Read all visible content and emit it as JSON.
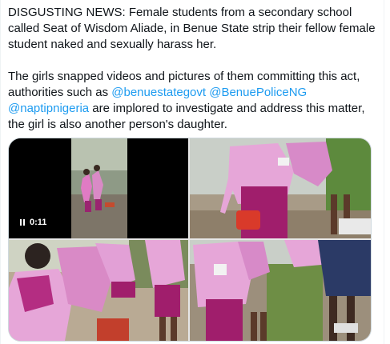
{
  "tweet": {
    "paragraph1": "DISGUSTING NEWS: Female students from a secondary school called Seat of Wisdom Aliade, in Benue State strip their fellow female student naked and sexually harass her.",
    "paragraph2_start": "The girls snapped videos and pictures of them committing this act, authorities such as ",
    "mentions": [
      "@benuestategovt",
      "@BenuePoliceNG",
      "@naptipnigeria"
    ],
    "paragraph2_end": " are implored to investigate and address this matter, the girl is also another person's daughter."
  },
  "media": {
    "video_time": "0:11",
    "video_state_icon": "pause-icon",
    "colors": {
      "uniform_pink": "#e8a8d8",
      "skirt_magenta": "#a0206c",
      "mention_blue": "#1d9bf0"
    }
  }
}
